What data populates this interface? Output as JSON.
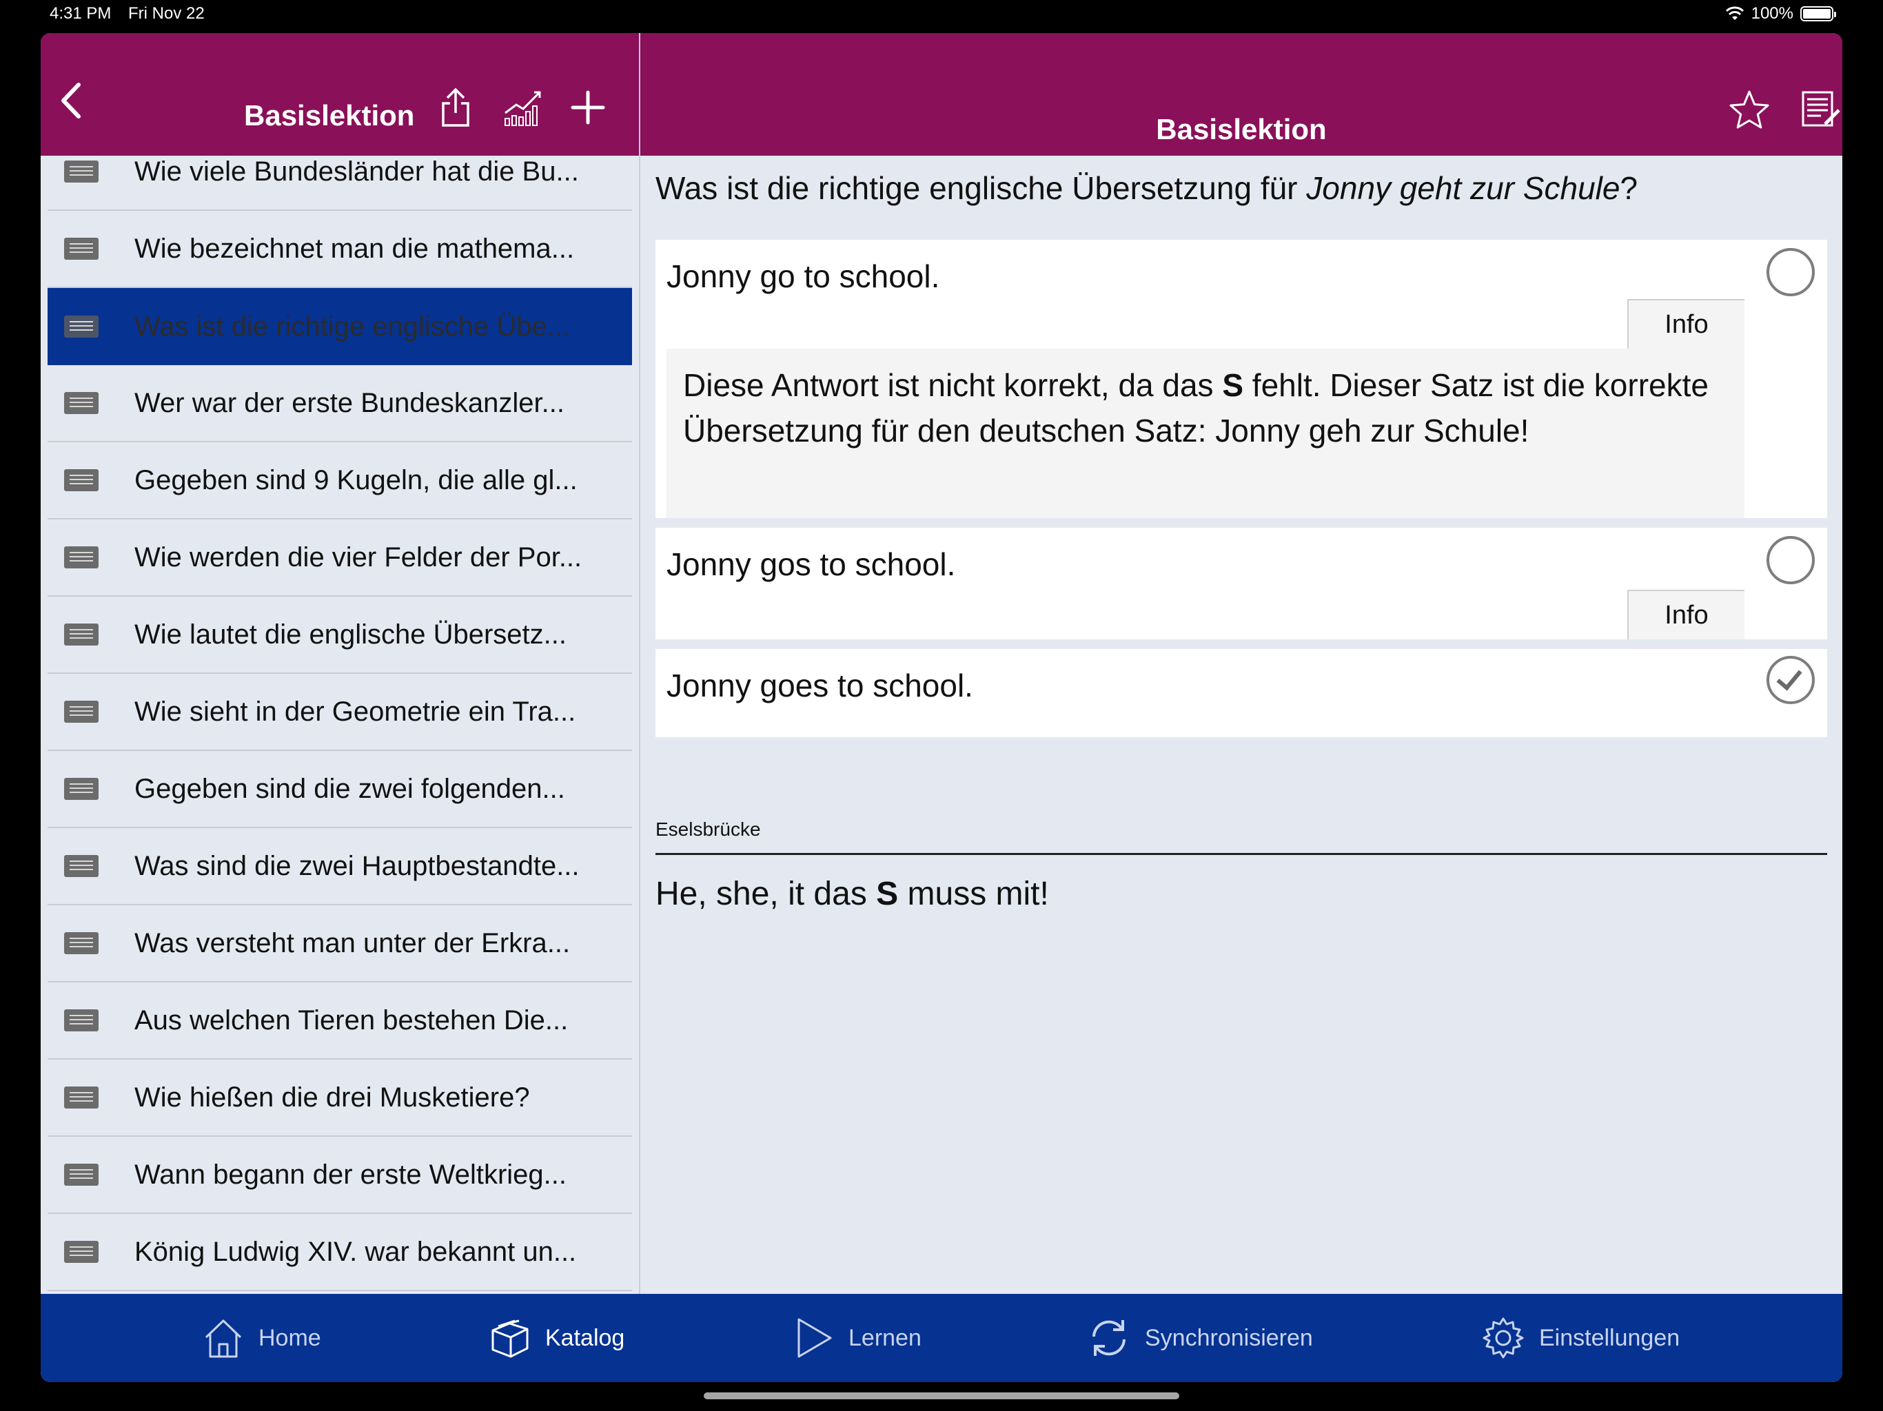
{
  "status_bar": {
    "time": "4:31 PM",
    "date": "Fri Nov 22",
    "battery": "100%"
  },
  "left_header": {
    "title": "Basislektion",
    "icons": [
      "back-chevron-icon",
      "share-icon",
      "statistics-icon",
      "add-icon"
    ]
  },
  "right_header": {
    "title": "Basislektion",
    "icons": [
      "star-icon",
      "edit-notes-icon"
    ]
  },
  "question_list": [
    {
      "text": "Wie viele Bundesländer hat die Bu...",
      "selected": false
    },
    {
      "text": "Wie bezeichnet man die mathema...",
      "selected": false
    },
    {
      "text": "Was ist die richtige englische Übe...",
      "selected": true
    },
    {
      "text": "Wer war der erste Bundeskanzler...",
      "selected": false
    },
    {
      "text": "Gegeben sind 9 Kugeln, die alle gl...",
      "selected": false
    },
    {
      "text": "Wie werden die vier Felder der Por...",
      "selected": false
    },
    {
      "text": "Wie lautet die englische Übersetz...",
      "selected": false
    },
    {
      "text": "Wie sieht in der Geometrie ein Tra...",
      "selected": false
    },
    {
      "text": "Gegeben sind die zwei folgenden...",
      "selected": false
    },
    {
      "text": "Was sind die zwei Hauptbestandte...",
      "selected": false
    },
    {
      "text": "Was versteht man unter der Erkra...",
      "selected": false
    },
    {
      "text": "Aus welchen Tieren bestehen Die...",
      "selected": false
    },
    {
      "text": "Wie hießen die drei Musketiere?",
      "selected": false
    },
    {
      "text": "Wann begann der erste Weltkrieg...",
      "selected": false
    },
    {
      "text": "König Ludwig XIV. war bekannt un...",
      "selected": false
    }
  ],
  "question": {
    "prefix": "Was ist die richtige englische Übersetzung für ",
    "italic": "Jonny geht zur Schule",
    "suffix": "?"
  },
  "answers": [
    {
      "text": "Jonny go to school.",
      "checked": false,
      "info_label": "Info",
      "info_expanded": true,
      "info_text_before": "Diese Antwort ist nicht korrekt, da das ",
      "info_text_bold": "S",
      "info_text_after": " fehlt. Dieser Satz ist die korrekte Übersetzung für den deutschen Satz: Jonny geh zur Schule!"
    },
    {
      "text": "Jonny gos to school.",
      "checked": false,
      "info_label": "Info",
      "info_expanded": false
    },
    {
      "text": "Jonny goes to school.",
      "checked": true
    }
  ],
  "mnemonic": {
    "label": "Eselsbrücke",
    "text_before": "He, she, it das ",
    "text_bold": "S",
    "text_after": " muss mit!"
  },
  "tabbar": [
    {
      "label": "Home",
      "icon": "home-icon",
      "active": false
    },
    {
      "label": "Katalog",
      "icon": "catalog-icon",
      "active": true
    },
    {
      "label": "Lernen",
      "icon": "play-icon",
      "active": false
    },
    {
      "label": "Synchronisieren",
      "icon": "sync-icon",
      "active": false
    },
    {
      "label": "Einstellungen",
      "icon": "gear-icon",
      "active": false
    }
  ],
  "colors": {
    "header": "#8a1059",
    "tabbar": "#063292",
    "selection": "#063292",
    "background": "#e4e9f1"
  }
}
